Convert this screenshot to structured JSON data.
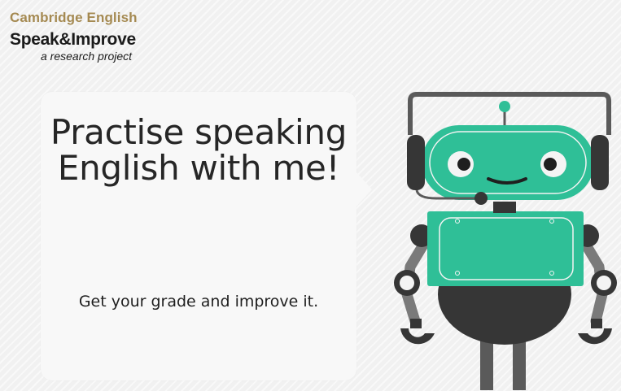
{
  "brand": {
    "org": "Cambridge English",
    "product": "Speak&Improve",
    "tagline": "a research project"
  },
  "hero": {
    "headline": "Practise speaking English with me!",
    "subline": "Get your grade and improve it."
  },
  "colors": {
    "accent_teal": "#2fbf97",
    "brand_gold": "#a58a52",
    "robot_dark": "#3a3a3a",
    "robot_gray": "#777777"
  },
  "icons": {
    "mascot": "robot-with-headset"
  }
}
